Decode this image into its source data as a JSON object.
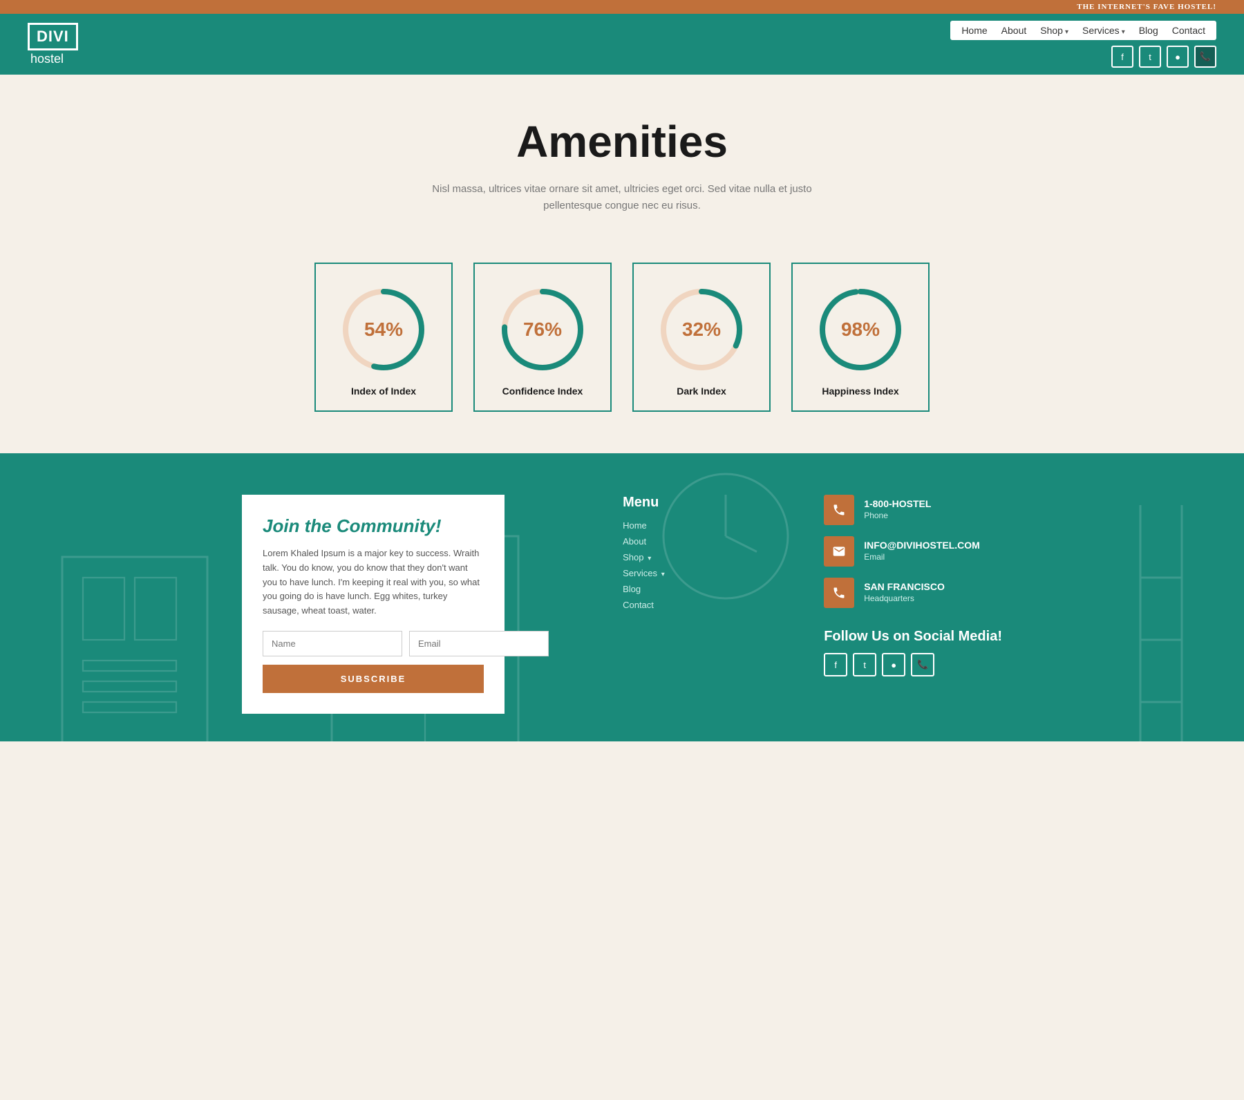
{
  "topbar": {
    "tagline": "THE INTERNET'S FAVE HOSTEL!"
  },
  "header": {
    "logo_divi": "DIVI",
    "logo_hostel": "hostel",
    "nav": {
      "home": "Home",
      "about": "About",
      "shop": "Shop",
      "services": "Services",
      "blog": "Blog",
      "contact": "Contact"
    },
    "social": [
      "f",
      "t",
      "☺",
      "✆"
    ]
  },
  "hero": {
    "title": "Amenities",
    "subtitle": "Nisl massa, ultrices vitae ornare sit amet, ultricies eget orci. Sed vitae nulla et justo pellentesque congue nec eu risus."
  },
  "metrics": [
    {
      "percent": 54,
      "label": "Index of Index"
    },
    {
      "percent": 76,
      "label": "Confidence Index"
    },
    {
      "percent": 32,
      "label": "Dark Index"
    },
    {
      "percent": 98,
      "label": "Happiness Index"
    }
  ],
  "community": {
    "heading": "Join the Community!",
    "body": "Lorem Khaled Ipsum is a major key to success. Wraith talk. You do know, you do know that they don't want you to have lunch. I'm keeping it real with you, so what you going do is have lunch. Egg whites, turkey sausage, wheat toast, water.",
    "name_placeholder": "Name",
    "email_placeholder": "Email",
    "subscribe_label": "SUBSCRIBE"
  },
  "footer_menu": {
    "heading": "Menu",
    "items": [
      {
        "label": "Home",
        "has_chevron": false
      },
      {
        "label": "About",
        "has_chevron": false
      },
      {
        "label": "Shop",
        "has_chevron": true
      },
      {
        "label": "Services",
        "has_chevron": true
      },
      {
        "label": "Blog",
        "has_chevron": false
      },
      {
        "label": "Contact",
        "has_chevron": false
      }
    ]
  },
  "footer_contact": {
    "items": [
      {
        "icon": "phone",
        "value": "1-800-HOSTEL",
        "label": "Phone"
      },
      {
        "icon": "email",
        "value": "INFO@DIVIHOSTEL.COM",
        "label": "Email"
      },
      {
        "icon": "location",
        "value": "SAN FRANCISCO",
        "label": "Headquarters"
      }
    ]
  },
  "footer_social": {
    "heading": "Follow Us on Social Media!",
    "icons": [
      "f",
      "t",
      "☺",
      "✆"
    ]
  },
  "colors": {
    "teal": "#1a8a7a",
    "orange": "#c0703a",
    "bg": "#f5f0e8",
    "dark": "#1a1a1a",
    "light_text": "#777"
  }
}
